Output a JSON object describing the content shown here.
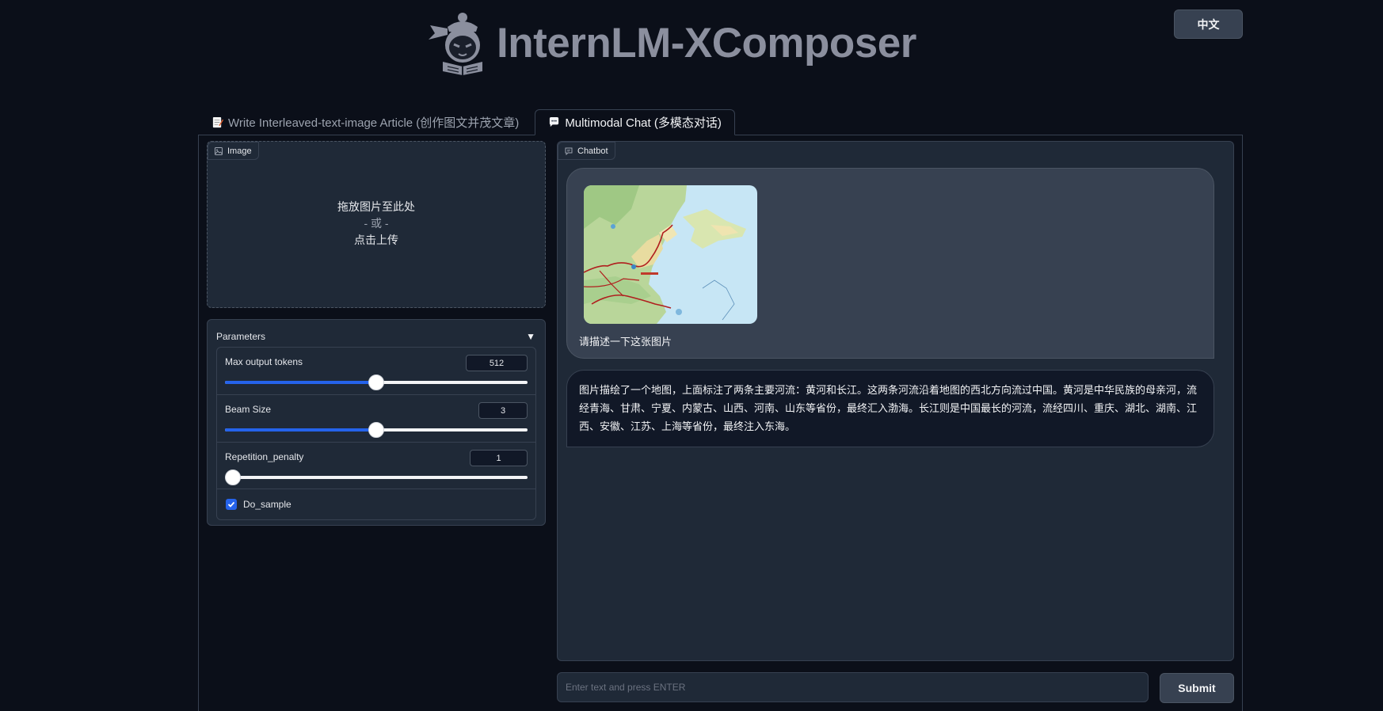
{
  "header": {
    "title": "InternLM-XComposer",
    "lang_button": "中文"
  },
  "tabs": [
    {
      "label": "Write Interleaved-text-image Article (创作图文并茂文章)",
      "icon": "memo-icon",
      "active": false
    },
    {
      "label": "Multimodal Chat (多模态对话)",
      "icon": "speech-bubble-icon",
      "active": true
    }
  ],
  "image_upload": {
    "label": "Image",
    "drop_text": "拖放图片至此处",
    "or_text": "- 或 -",
    "click_text": "点击上传"
  },
  "parameters": {
    "title": "Parameters",
    "sliders": [
      {
        "label": "Max output tokens",
        "value": "512",
        "fraction": 0.5
      },
      {
        "label": "Beam Size",
        "value": "3",
        "fraction": 0.5
      },
      {
        "label": "Repetition_penalty",
        "value": "1",
        "fraction": 0.0
      }
    ],
    "do_sample": {
      "label": "Do_sample",
      "checked": true
    }
  },
  "chatbot": {
    "label": "Chatbot",
    "user_message": "请描述一下这张图片",
    "bot_message": "图片描绘了一个地图，上面标注了两条主要河流：黄河和长江。这两条河流沿着地图的西北方向流过中国。黄河是中华民族的母亲河，流经青海、甘肃、宁夏、内蒙古、山西、河南、山东等省份，最终汇入渤海。长江则是中国最长的河流，流经四川、重庆、湖北、湖南、江西、安徽、江苏、上海等省份，最终注入东海。"
  },
  "input": {
    "placeholder": "Enter text and press ENTER",
    "value": ""
  },
  "submit_label": "Submit",
  "colors": {
    "background": "#0b0f19",
    "panel": "#1f2937",
    "accent": "#2563eb",
    "title": "#8b8f9e"
  }
}
